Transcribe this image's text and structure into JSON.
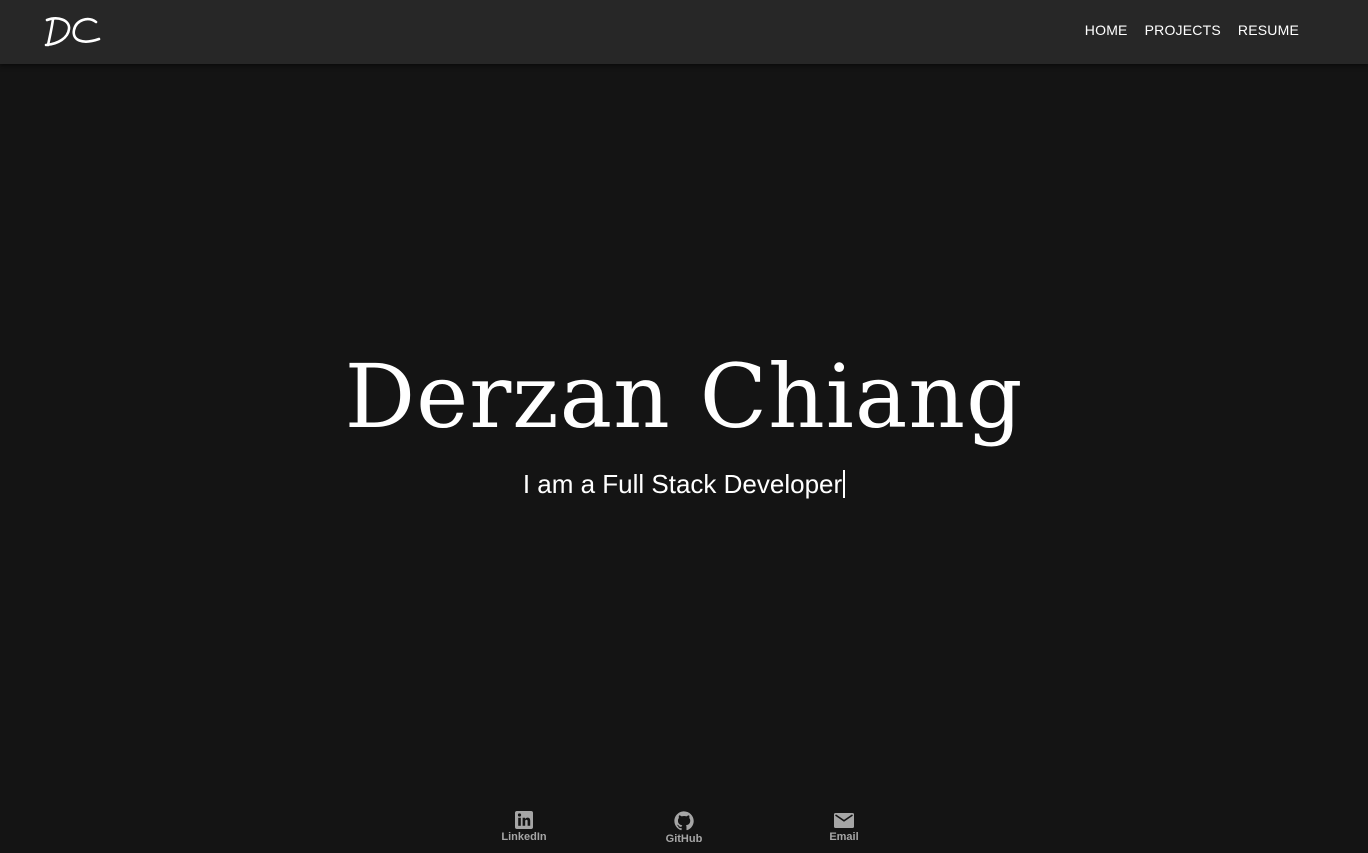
{
  "brand": {
    "logo_text": "DC"
  },
  "nav": {
    "items": [
      {
        "label": "HOME"
      },
      {
        "label": "PROJECTS"
      },
      {
        "label": "RESUME"
      }
    ]
  },
  "hero": {
    "name": "Derzan Chiang",
    "tagline": "I am a Full Stack Developer"
  },
  "social": {
    "links": [
      {
        "label": "LinkedIn",
        "icon": "linkedin-icon"
      },
      {
        "label": "GitHub",
        "icon": "github-icon"
      },
      {
        "label": "Email",
        "icon": "email-icon"
      }
    ]
  },
  "colors": {
    "background": "#141414",
    "navbar": "#272727",
    "text": "#ffffff",
    "social_icon": "#a6a6a6"
  }
}
